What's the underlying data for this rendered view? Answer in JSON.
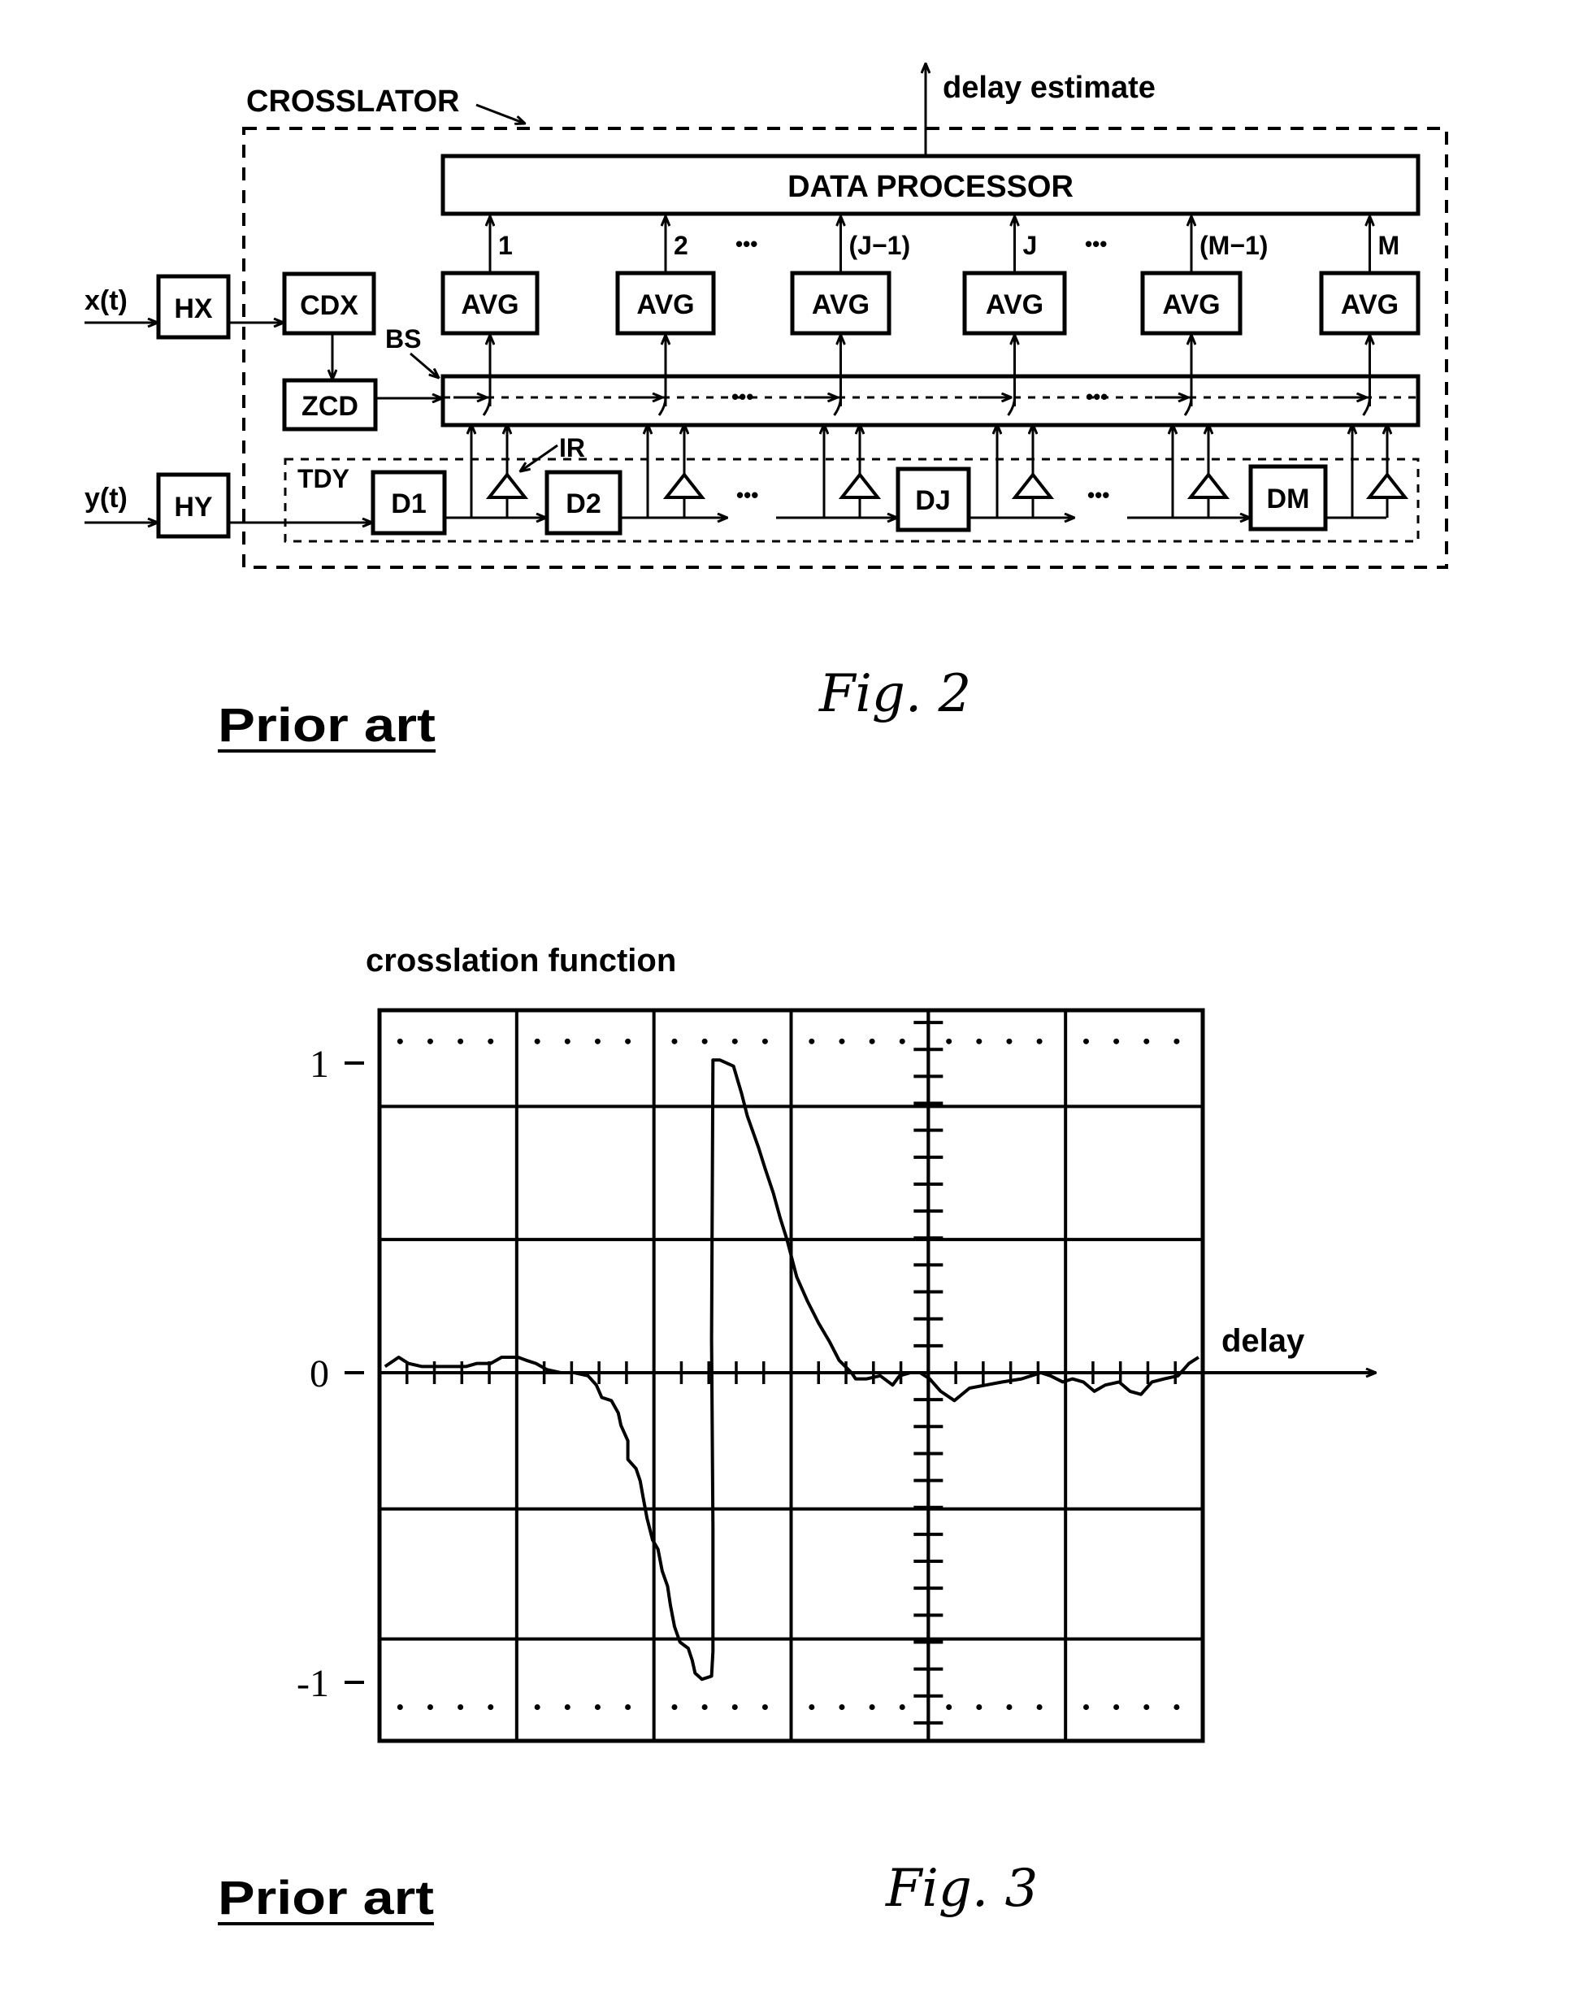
{
  "figure2": {
    "title_label": "CROSSLATOR",
    "output_label": "delay estimate",
    "data_processor_label": "DATA PROCESSOR",
    "input_x_label": "x(t)",
    "input_y_label": "y(t)",
    "hx_label": "HX",
    "hy_label": "HY",
    "cdx_label": "CDX",
    "zcd_label": "ZCD",
    "bs_label": "BS",
    "ir_label": "IR",
    "tdy_label": "TDY",
    "ellipsis": "•••",
    "avg_blocks": [
      {
        "label": "AVG",
        "channel": "1"
      },
      {
        "label": "AVG",
        "channel": "2"
      },
      {
        "label": "AVG",
        "channel": "(J−1)"
      },
      {
        "label": "AVG",
        "channel": "J"
      },
      {
        "label": "AVG",
        "channel": "(M−1)"
      },
      {
        "label": "AVG",
        "channel": "M"
      }
    ],
    "delay_blocks": [
      "D1",
      "D2",
      "DJ",
      "DM"
    ],
    "prior_art_label": "Prior art",
    "caption": "Fig. 2"
  },
  "figure3": {
    "prior_art_label": "Prior art",
    "caption": "Fig. 3"
  },
  "chart_data": {
    "type": "line",
    "title": "crosslation function",
    "xlabel": "delay",
    "ylabel": "",
    "xlim": [
      -4,
      2
    ],
    "ylim": [
      -1.19,
      1.17
    ],
    "grid": true,
    "x_gridlines": [
      -4,
      -3,
      -2,
      -1,
      0,
      1,
      2
    ],
    "y_gridlines": [
      1.17,
      0.86,
      0.43,
      0,
      -0.44,
      -0.86,
      -1.19
    ],
    "y_ticks": [
      {
        "value": 1,
        "label": "1"
      },
      {
        "value": 0,
        "label": "0"
      },
      {
        "value": -1,
        "label": "-1"
      }
    ],
    "reference_dotted_levels": [
      1.07,
      -1.08
    ],
    "series": [
      {
        "name": "crosslation function",
        "x": [
          -3.96,
          -3.86,
          -3.79,
          -3.69,
          -3.59,
          -3.49,
          -3.37,
          -3.29,
          -3.19,
          -3.11,
          -2.99,
          -2.93,
          -2.86,
          -2.78,
          -2.68,
          -2.58,
          -2.48,
          -2.42,
          -2.38,
          -2.31,
          -2.26,
          -2.24,
          -2.19,
          -2.19,
          -2.13,
          -2.1,
          -2.08,
          -2.05,
          -2.01,
          -1.97,
          -1.94,
          -1.9,
          -1.88,
          -1.85,
          -1.81,
          -1.75,
          -1.72,
          -1.7,
          -1.65,
          -1.58,
          -1.57,
          -1.57,
          -1.58,
          -1.57,
          -1.52,
          -1.42,
          -1.36,
          -1.32,
          -1.24,
          -1.19,
          -1.13,
          -1.08,
          -1.03,
          -0.96,
          -0.88,
          -0.8,
          -0.72,
          -0.65,
          -0.56,
          -0.53,
          -0.45,
          -0.35,
          -0.26,
          -0.21,
          -0.13,
          -0.06,
          0.01,
          0.09,
          0.19,
          0.3,
          0.42,
          0.54,
          0.68,
          0.82,
          0.89,
          0.98,
          1.05,
          1.13,
          1.21,
          1.29,
          1.39,
          1.47,
          1.55,
          1.63,
          1.72,
          1.82,
          1.9,
          1.97
        ],
        "y": [
          0.02,
          0.05,
          0.03,
          0.02,
          0.02,
          0.02,
          0.02,
          0.03,
          0.03,
          0.05,
          0.05,
          0.04,
          0.03,
          0.01,
          0.0,
          0.0,
          -0.01,
          -0.04,
          -0.08,
          -0.09,
          -0.13,
          -0.17,
          -0.22,
          -0.28,
          -0.31,
          -0.35,
          -0.4,
          -0.47,
          -0.54,
          -0.57,
          -0.64,
          -0.69,
          -0.75,
          -0.82,
          -0.87,
          -0.89,
          -0.93,
          -0.97,
          -0.99,
          -0.98,
          -0.9,
          -0.5,
          0.11,
          1.01,
          1.01,
          0.99,
          0.9,
          0.83,
          0.73,
          0.66,
          0.58,
          0.5,
          0.43,
          0.31,
          0.23,
          0.16,
          0.1,
          0.04,
          0.0,
          -0.02,
          -0.02,
          -0.01,
          -0.04,
          -0.01,
          0.0,
          0.0,
          -0.02,
          -0.06,
          -0.09,
          -0.05,
          -0.04,
          -0.03,
          -0.02,
          0.0,
          -0.01,
          -0.03,
          -0.02,
          -0.03,
          -0.06,
          -0.04,
          -0.03,
          -0.06,
          -0.07,
          -0.03,
          -0.02,
          -0.01,
          0.03,
          0.05
        ]
      }
    ]
  }
}
